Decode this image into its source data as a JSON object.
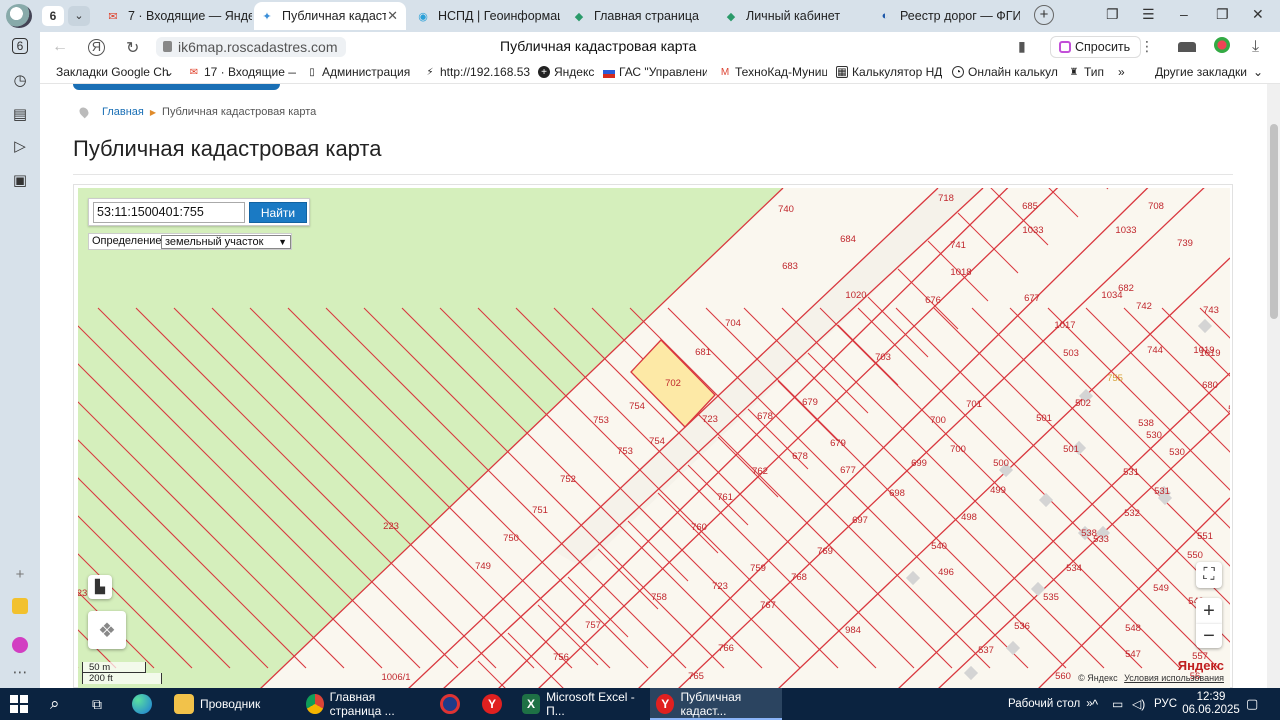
{
  "browser": {
    "tab_counter": "6",
    "tabs": [
      {
        "label": "7 · Входящие — Яндекс",
        "icon": "mail-icon"
      },
      {
        "label": "Публичная кадастровая карта",
        "icon": "cadastre-icon"
      },
      {
        "label": "НСПД | Геоинформация",
        "icon": "nspd-icon"
      },
      {
        "label": "Главная страница",
        "icon": "gosuslugi-icon"
      },
      {
        "label": "Личный кабинет",
        "icon": "gosuslugi-icon"
      },
      {
        "label": "Реестр дорог — ФГИС",
        "icon": "road-registry-icon"
      }
    ],
    "url": "ik6map.roscadastres.com",
    "page_title": "Публичная кадастровая карта",
    "ask_label": "Спросить",
    "bookmarks": [
      "Закладки Google Ch",
      "17 · Входящие — Я",
      "Администрация (",
      "http://192.168.53.",
      "Яндекс",
      "ГАС \"Управление",
      "ТехноКад-Муниц",
      "Калькулятор НДС",
      "Онлайн калькуля",
      "Тип"
    ],
    "other_bookmarks": "Другие закладки",
    "more": "»"
  },
  "page": {
    "breadcrumb_home": "Главная",
    "breadcrumb_current": "Публичная кадастровая карта",
    "heading": "Публичная кадастровая карта"
  },
  "map": {
    "search_value": "53:11:1500401:755",
    "search_button": "Найти",
    "definition_label": "Определение:",
    "definition_value": "земельный участок",
    "scale_metric": "50 m",
    "scale_imperial": "200 ft",
    "copyright": "© Яндекс",
    "terms": "Условия использования",
    "yandex_logo": "Яндекс",
    "selected_parcel": "755",
    "parcel_labels": [
      "223",
      "23",
      "1006/1",
      "718",
      "685",
      "708",
      "1033",
      "1033",
      "739",
      "740",
      "684",
      "741",
      "683",
      "1018",
      "1034",
      "742",
      "677",
      "1020",
      "682",
      "743",
      "676",
      "704",
      "1017",
      "1019",
      "1019",
      "744",
      "681",
      "703",
      "503",
      "755",
      "680",
      "702",
      "502",
      "529",
      "754",
      "723",
      "678",
      "679",
      "700",
      "701",
      "501",
      "753",
      "754",
      "679",
      "700",
      "501",
      "538",
      "530",
      "530",
      "753",
      "762",
      "678",
      "677",
      "699",
      "500",
      "531",
      "752",
      "761",
      "698",
      "499",
      "531",
      "751",
      "760",
      "697",
      "498",
      "532",
      "750",
      "540",
      "538",
      "533",
      "551",
      "749",
      "759",
      "769",
      "496",
      "534",
      "550",
      "550",
      "758",
      "723",
      "768",
      "549",
      "549",
      "757",
      "767",
      "535",
      "536",
      "756",
      "984",
      "548",
      "766",
      "537",
      "547",
      "557",
      "765",
      "560",
      "56"
    ]
  },
  "taskbar": {
    "apps": [
      {
        "label": "Проводник",
        "icon": "folder-icon"
      },
      {
        "label": "Главная страница ...",
        "icon": "chrome-icon"
      },
      {
        "label": "",
        "icon": "app-icon"
      },
      {
        "label": "",
        "icon": "yandex-icon"
      },
      {
        "label": "Microsoft Excel - П...",
        "icon": "excel-icon"
      },
      {
        "label": "Публичная кадаст...",
        "icon": "yandex-browser-icon"
      }
    ],
    "desktop_label": "Рабочий стол",
    "language": "РУС",
    "time": "12:39",
    "date": "06.06.2025"
  },
  "colors": {
    "parcel_border": "#d9383f",
    "parcel_label": "#c0272d",
    "selected_fill": "#fde9a6",
    "forest": "#d5efbc",
    "accent": "#1a7ac4",
    "taskbar": "#0b2340"
  }
}
